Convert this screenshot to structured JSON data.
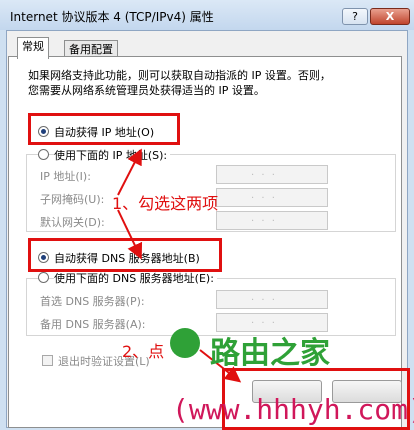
{
  "window": {
    "title": "Internet 协议版本 4 (TCP/IPv4) 属性",
    "help_label": "?",
    "close_label": "X"
  },
  "tabs": [
    {
      "label": "常规",
      "active": true
    },
    {
      "label": "备用配置",
      "active": false
    }
  ],
  "intro": {
    "line1": "如果网络支持此功能，则可以获取自动指派的 IP 设置。否则，",
    "line2": "您需要从网络系统管理员处获得适当的 IP 设置。"
  },
  "ip": {
    "auto_label": "自动获得 IP 地址(O)",
    "auto_selected": true,
    "manual_label": "使用下面的 IP 地址(S):",
    "fields": [
      {
        "label": "IP 地址(I):",
        "value": ""
      },
      {
        "label": "子网掩码(U):",
        "value": ""
      },
      {
        "label": "默认网关(D):",
        "value": ""
      }
    ]
  },
  "dns": {
    "auto_label": "自动获得 DNS 服务器地址(B)",
    "auto_selected": true,
    "manual_label": "使用下面的 DNS 服务器地址(E):",
    "fields": [
      {
        "label": "首选 DNS 服务器(P):",
        "value": ""
      },
      {
        "label": "备用 DNS 服务器(A):",
        "value": ""
      }
    ]
  },
  "footer": {
    "validate_label": "退出时验证设置(L)",
    "validate_checked": false
  },
  "annotations": {
    "step1": "1、勾选这两项",
    "step2": "2、点"
  },
  "watermark": {
    "brand": "路由之家",
    "url": "(www.hhhyh.com)"
  },
  "colors": {
    "annotation_red": "#e01010",
    "brand_green": "#2fa137",
    "url_pink": "#d0175a"
  }
}
